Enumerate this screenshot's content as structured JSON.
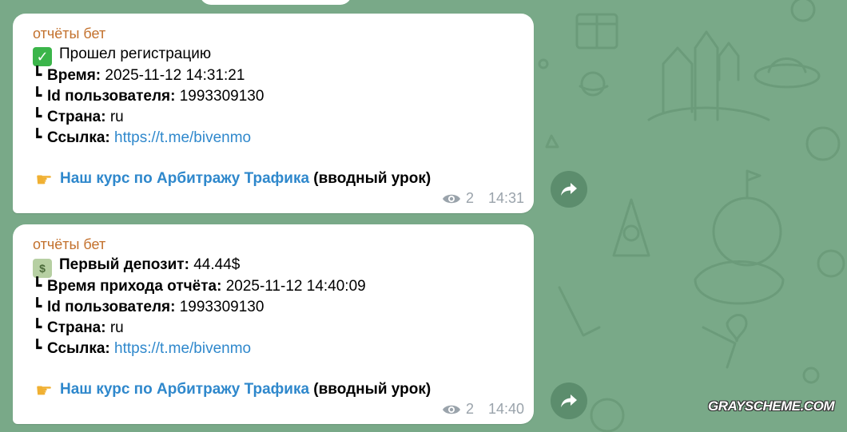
{
  "messages": [
    {
      "sender": "отчёты бет",
      "headline_label": "Прошел регистрацию",
      "rows": [
        {
          "label": "Время:",
          "value": "2025-11-12 14:31:21"
        },
        {
          "label": "Id пользователя:",
          "value": "1993309130"
        },
        {
          "label": "Страна:",
          "value": "ru"
        },
        {
          "label": "Ссылка:",
          "link": "https://t.me/bivenmo"
        }
      ],
      "course_link": "Наш курс по Арбитражу Трафика",
      "course_suffix": "(вводный урок)",
      "views": "2",
      "time": "14:31"
    },
    {
      "sender": "отчёты бет",
      "headline_label": "Первый депозит:",
      "headline_value": "44.44$",
      "rows": [
        {
          "label": "Время прихода отчёта:",
          "value": "2025-11-12 14:40:09"
        },
        {
          "label": "Id пользователя:",
          "value": "1993309130"
        },
        {
          "label": "Страна:",
          "value": "ru"
        },
        {
          "label": "Ссылка:",
          "link": "https://t.me/bivenmo"
        }
      ],
      "course_link": "Наш курс по Арбитражу Трафика",
      "course_suffix": "(вводный урок)",
      "views": "2",
      "time": "14:40"
    }
  ],
  "corner_glyph": "┗",
  "watermark": "GRAYSCHEME.COM",
  "colors": {
    "background": "#79a988",
    "bubble": "#ffffff",
    "sender": "#c3712d",
    "link": "#2f88cc",
    "meta": "#9aa3ab"
  },
  "icons": [
    "check-mark-emoji",
    "money-emoji",
    "pointing-finger-emoji",
    "eye-icon",
    "share-icon"
  ]
}
